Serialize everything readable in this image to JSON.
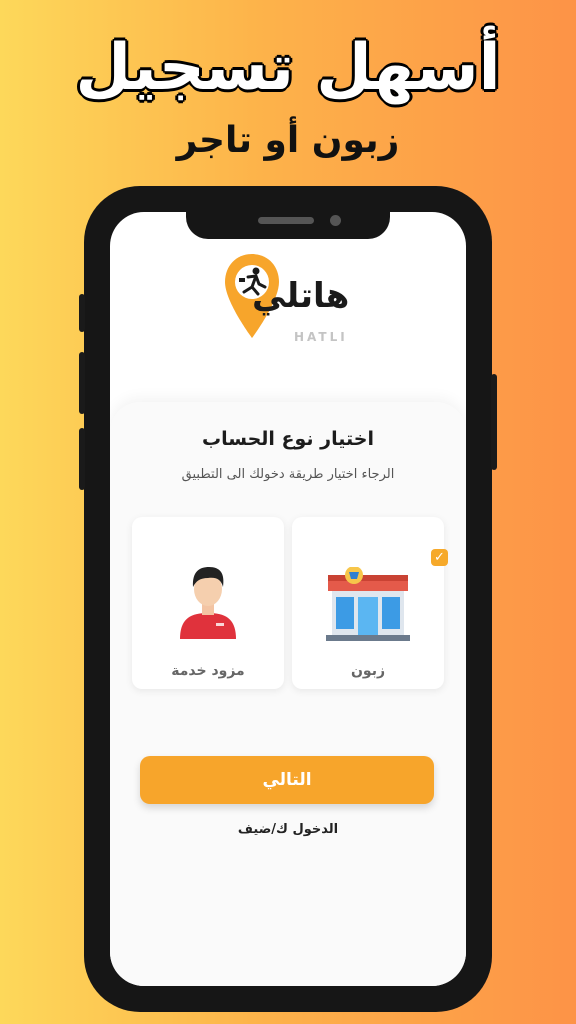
{
  "promo": {
    "headline": "أسهل تسجيل",
    "subheadline": "زبون أو تاجر"
  },
  "app": {
    "logo_text": "هاتلي",
    "logo_latin": "HATLI",
    "brand_color": "#f7a52b"
  },
  "account_type": {
    "title": "اختيار نوع الحساب",
    "subtitle": "الرجاء اختيار طريقة دخولك الى التطبيق",
    "options": [
      {
        "label": "زبون",
        "icon": "shop-icon",
        "selected": true
      },
      {
        "label": "مزود خدمة",
        "icon": "person-icon",
        "selected": false
      }
    ]
  },
  "actions": {
    "next_label": "التالي",
    "guest_label": "الدخول ك/ضيف"
  },
  "icons": {
    "check": "✓"
  }
}
